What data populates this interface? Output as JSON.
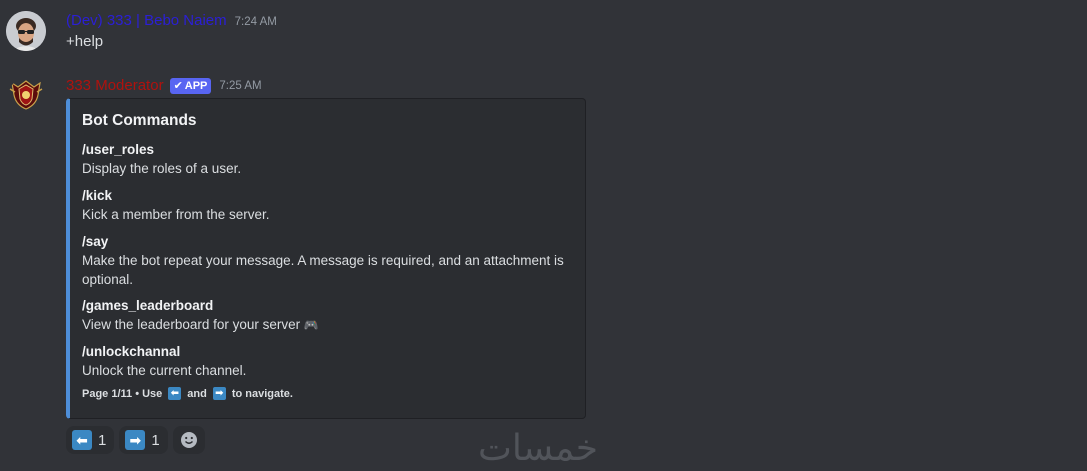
{
  "messages": [
    {
      "username": "(Dev) 333 | Bebo Naiem",
      "timestamp": "7:24 AM",
      "content": "+help"
    },
    {
      "username": "333 Moderator",
      "badge": "APP",
      "timestamp": "7:25 AM"
    }
  ],
  "embed": {
    "title": "Bot Commands",
    "accent_color": "#4e8ed8",
    "commands": [
      {
        "name": "/user_roles",
        "description": "Display the roles of a user."
      },
      {
        "name": "/kick",
        "description": "Kick a member from the server."
      },
      {
        "name": "/say",
        "description": "Make the bot repeat your message. A message is required, and an attachment is optional."
      },
      {
        "name": "/games_leaderboard",
        "description": "View the leaderboard for your server"
      },
      {
        "name": "/unlockchannal",
        "description": "Unlock the current channel."
      }
    ],
    "footer": {
      "prefix": "Page 1/11 • Use",
      "middle": "and",
      "suffix": "to navigate."
    }
  },
  "reactions": [
    {
      "emoji": "arrow-left-icon",
      "count": "1"
    },
    {
      "emoji": "arrow-right-icon",
      "count": "1"
    }
  ],
  "watermark": "خمسات",
  "colors": {
    "background": "#313338",
    "embed_background": "#2b2d31",
    "dev_username": "#2b1fd6",
    "bot_username": "#b0120e",
    "app_badge": "#5865f2",
    "arrow_emoji": "#3b88c3"
  }
}
